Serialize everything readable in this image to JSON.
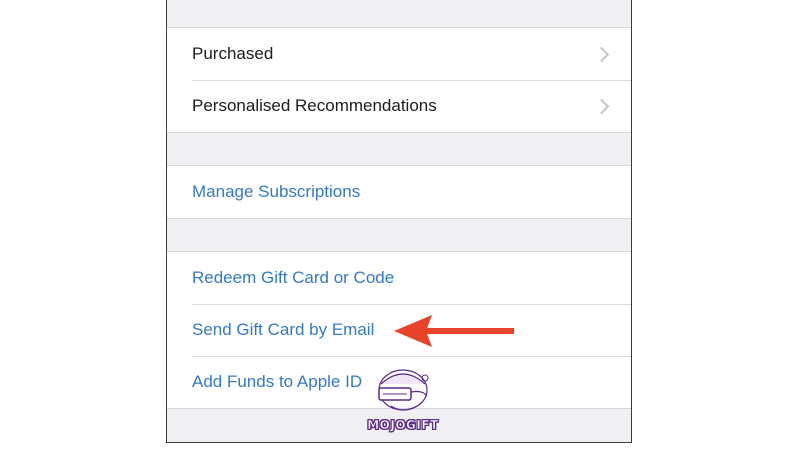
{
  "groups": [
    {
      "rows": [
        {
          "label": "Purchased",
          "has_chevron": true,
          "is_link": false
        },
        {
          "label": "Personalised Recommendations",
          "has_chevron": true,
          "is_link": false
        }
      ]
    },
    {
      "rows": [
        {
          "label": "Manage Subscriptions",
          "has_chevron": false,
          "is_link": true
        }
      ]
    },
    {
      "rows": [
        {
          "label": "Redeem Gift Card or Code",
          "has_chevron": false,
          "is_link": true
        },
        {
          "label": "Send Gift Card by Email",
          "has_chevron": false,
          "is_link": true
        },
        {
          "label": "Add Funds to Apple ID",
          "has_chevron": false,
          "is_link": true
        }
      ]
    }
  ],
  "watermark": {
    "text": "MOJOGIFT"
  },
  "colors": {
    "link": "#3479c9",
    "text": "#1c1c1e",
    "background": "#efeff4",
    "arrow": "#e8432a",
    "watermark_purple": "#5b2a86"
  },
  "icons": {
    "chevron": "chevron-right-icon",
    "annotation": "red-arrow-left-icon",
    "watermark": "mojogift-mascot-logo"
  }
}
